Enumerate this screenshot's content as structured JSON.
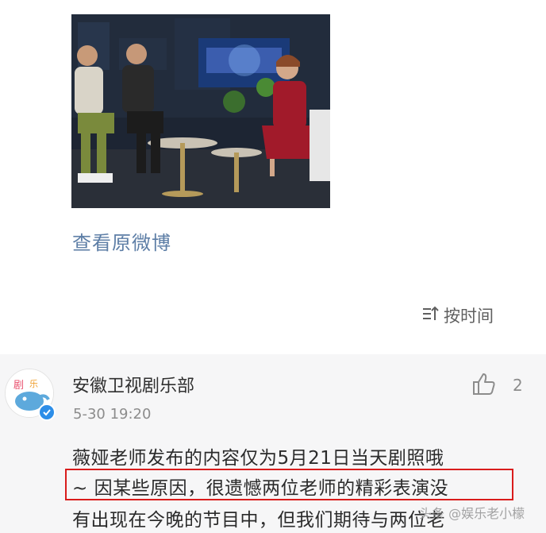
{
  "post": {
    "view_original_label": "查看原微博"
  },
  "sort": {
    "label": "按时间"
  },
  "comment": {
    "username": "安徽卫视剧乐部",
    "timestamp": "5-30 19:20",
    "like_count": "2",
    "lines": [
      "薇娅老师发布的内容仅为5月21日当天剧照哦",
      "~ 因某些原因，很遗憾两位老师的精彩表演没",
      "有出现在今晚的节目中，但我们期待与两位老"
    ]
  },
  "watermark": {
    "text": "头条 @娱乐老小檬"
  },
  "colors": {
    "link": "#5d7ea6",
    "highlight_border": "#d91c1c",
    "verified": "#2d8ee8"
  }
}
